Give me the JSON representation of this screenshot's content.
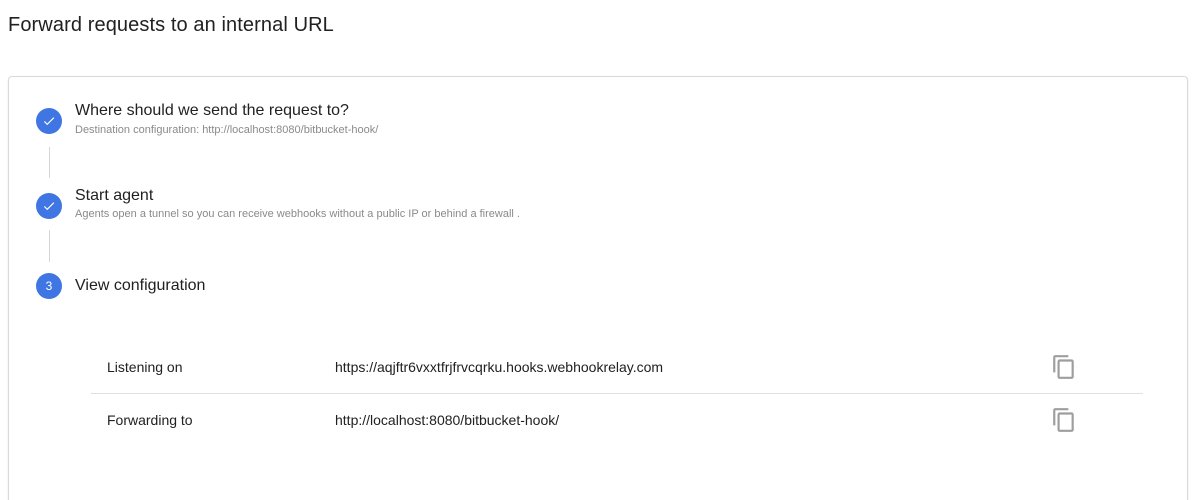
{
  "page": {
    "title": "Forward requests to an internal URL"
  },
  "steps": [
    {
      "indicator": "check-icon",
      "title": "Where should we send the request to?",
      "subtitle": "Destination configuration: http://localhost:8080/bitbucket-hook/"
    },
    {
      "indicator": "check-icon",
      "title": "Start agent",
      "subtitle": "Agents open a tunnel so you can receive webhooks without a public IP or behind a firewall ."
    },
    {
      "indicator": "3",
      "title": "View configuration",
      "subtitle": ""
    }
  ],
  "config": {
    "rows": [
      {
        "label": "Listening on",
        "value": "https://aqjftr6vxxtfrjfrvcqrku.hooks.webhookrelay.com",
        "action_icon": "copy-icon"
      },
      {
        "label": "Forwarding to",
        "value": "http://localhost:8080/bitbucket-hook/",
        "action_icon": "copy-icon"
      }
    ]
  },
  "colors": {
    "accent": "#3f76e3",
    "subtitle": "#8a8a8a",
    "icon": "#9e9e9e",
    "divider": "#e0e0e0"
  }
}
